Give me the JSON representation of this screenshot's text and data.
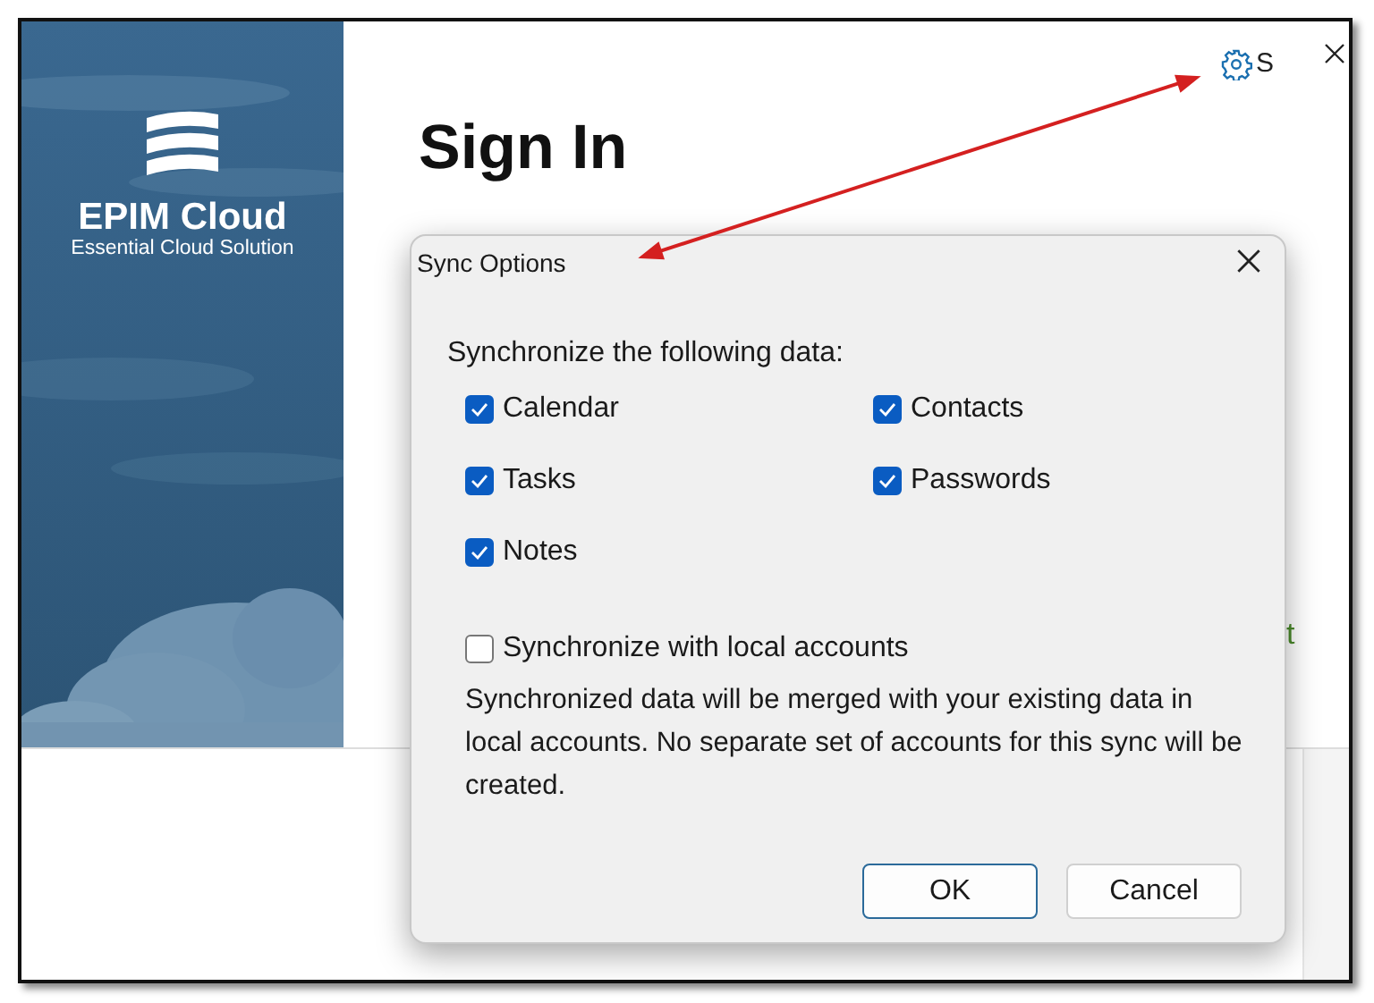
{
  "window": {
    "title": "Sign In",
    "settings_label": "S",
    "side_text": "t"
  },
  "brand": {
    "name": "EPIM Cloud",
    "tagline": "Essential Cloud Solution"
  },
  "dialog": {
    "title": "Sync Options",
    "heading": "Synchronize the following data:",
    "options": [
      {
        "label": "Calendar",
        "checked": true
      },
      {
        "label": "Contacts",
        "checked": true
      },
      {
        "label": "Tasks",
        "checked": true
      },
      {
        "label": "Passwords",
        "checked": true
      },
      {
        "label": "Notes",
        "checked": true
      }
    ],
    "local_sync": {
      "label": "Synchronize with local accounts",
      "checked": false
    },
    "note": "Synchronized data will be merged with your existing data in local accounts. No separate set of accounts for this sync will be created.",
    "buttons": [
      {
        "label": "OK",
        "kind": "primary"
      },
      {
        "label": "Cancel",
        "kind": "secondary"
      }
    ]
  }
}
